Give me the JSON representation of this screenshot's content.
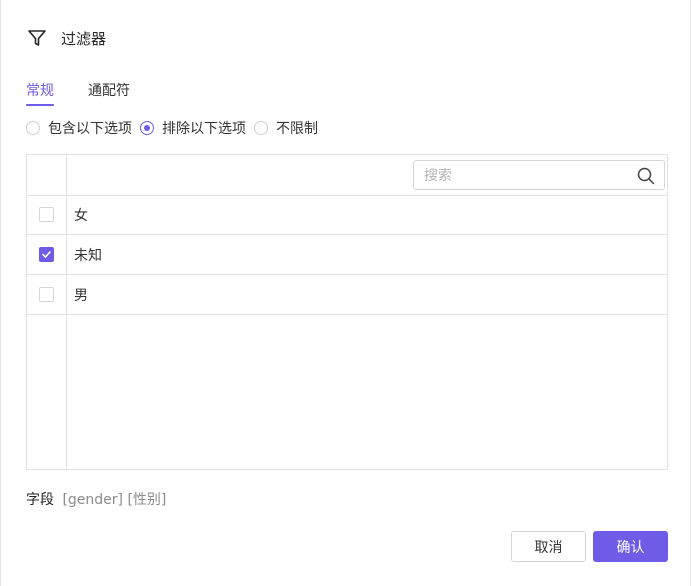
{
  "dialog": {
    "title": "过滤器",
    "icon": "filter-icon"
  },
  "tabs": [
    {
      "label": "常规",
      "active": true
    },
    {
      "label": "通配符",
      "active": false
    }
  ],
  "mode_options": [
    {
      "label": "包含以下选项",
      "checked": false
    },
    {
      "label": "排除以下选项",
      "checked": true
    },
    {
      "label": "不限制",
      "checked": false
    }
  ],
  "search": {
    "placeholder": "搜索",
    "value": ""
  },
  "options": [
    {
      "label": "女",
      "checked": false
    },
    {
      "label": "未知",
      "checked": true
    },
    {
      "label": "男",
      "checked": false
    }
  ],
  "field": {
    "label": "字段",
    "value": "[gender] [性别]"
  },
  "buttons": {
    "cancel": "取消",
    "confirm": "确认"
  },
  "colors": {
    "accent": "#6e5be6",
    "border": "#e3e3e3",
    "muted_text": "#8c8c8c"
  }
}
